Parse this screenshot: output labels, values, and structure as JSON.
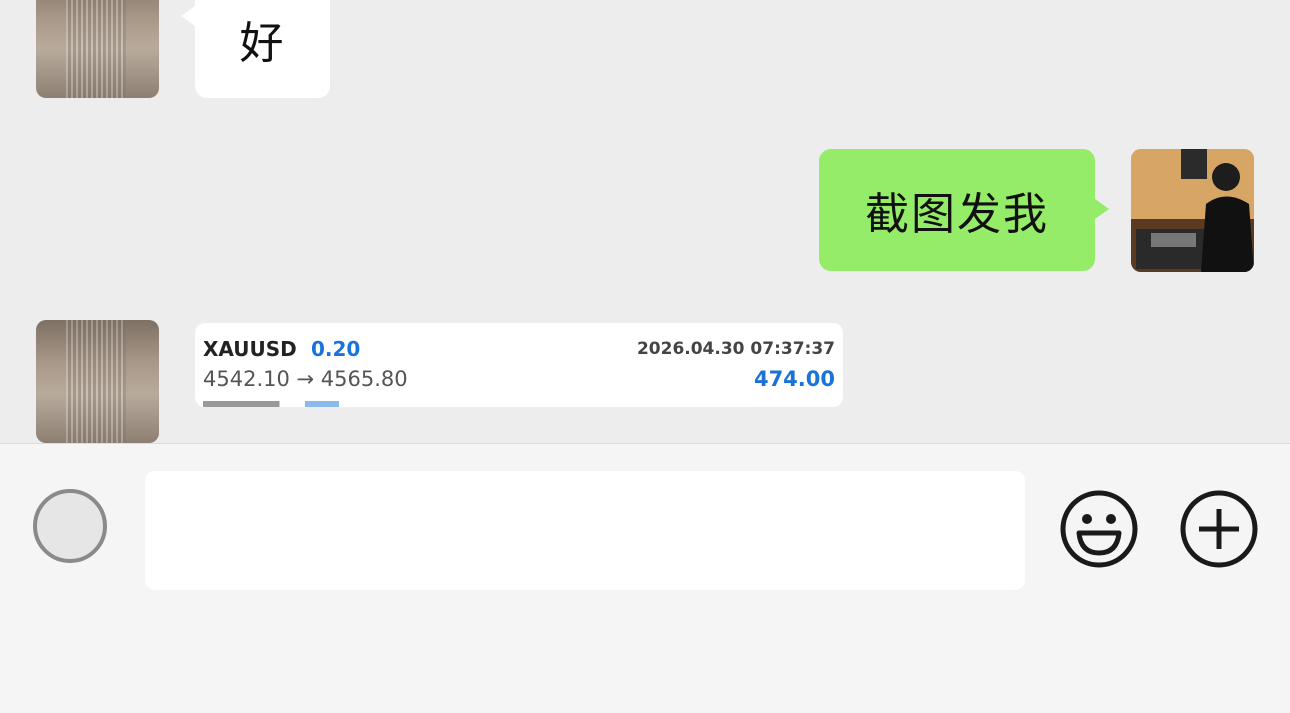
{
  "chat": {
    "messages": [
      {
        "side": "left",
        "type": "text",
        "text": "好"
      },
      {
        "side": "right",
        "type": "text",
        "text": "截图发我"
      },
      {
        "side": "left",
        "type": "trade-image",
        "trade": {
          "symbol": "XAUUSD",
          "lot": "0.20",
          "time": "2026.04.30 07:37:37",
          "prices": "4542.10 → 4565.80",
          "profit": "474.00"
        }
      }
    ]
  },
  "input": {
    "placeholder": "",
    "voice_icon": "voice-icon",
    "emoji_icon": "emoji-icon",
    "plus_icon": "plus-icon"
  },
  "colors": {
    "chat_bg": "#ededed",
    "self_bubble": "#95ec69",
    "other_bubble": "#ffffff",
    "profit_blue": "#1a73d9"
  }
}
